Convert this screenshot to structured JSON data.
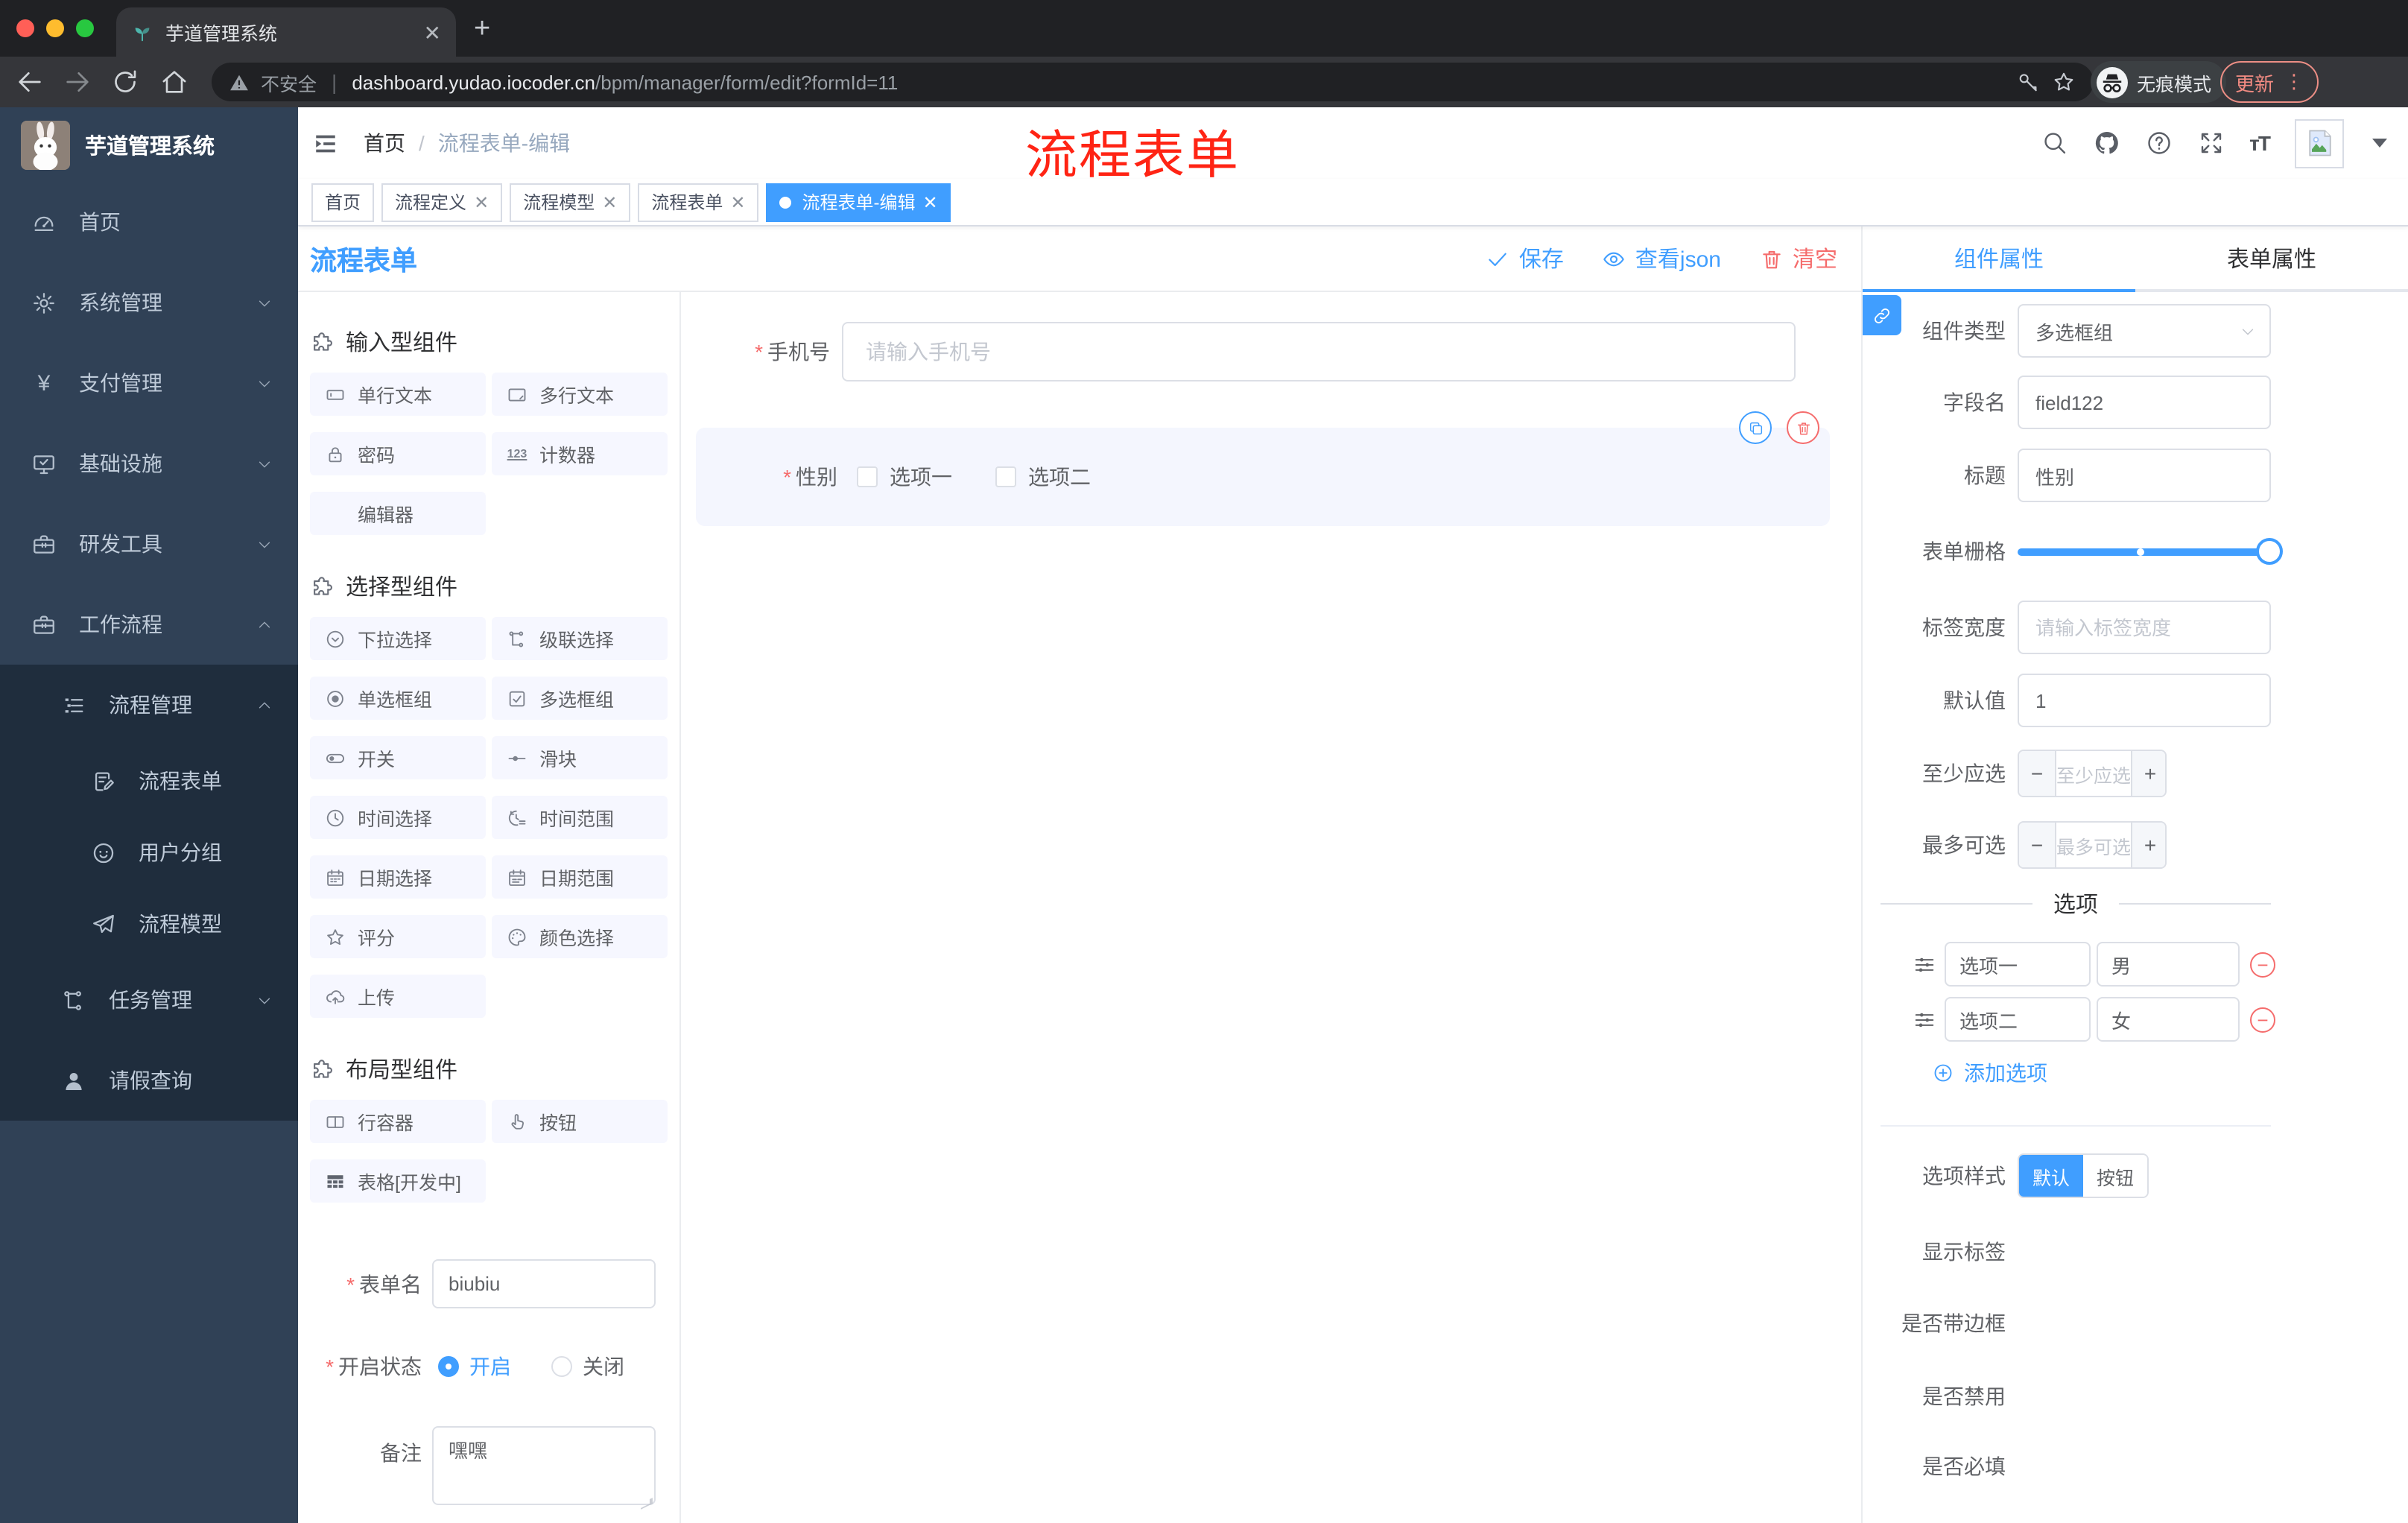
{
  "browser": {
    "tab_title": "芋道管理系统",
    "security_label": "不安全",
    "url_domain": "dashboard.yudao.iocoder.cn",
    "url_path": "/bpm/manager/form/edit?formId=11",
    "incognito_label": "无痕模式",
    "update_label": "更新"
  },
  "annotation": {
    "text": "流程表单"
  },
  "sidebar": {
    "app_title": "芋道管理系统",
    "items": [
      "首页",
      "系统管理",
      "支付管理",
      "基础设施",
      "研发工具",
      "工作流程"
    ],
    "submenu": [
      "流程管理",
      "流程表单",
      "用户分组",
      "流程模型",
      "任务管理",
      "请假查询"
    ]
  },
  "navbar": {
    "breadcrumb_home": "首页",
    "breadcrumb_sep": "/",
    "breadcrumb_current": "流程表单-编辑"
  },
  "tags_view": {
    "tabs": [
      "首页",
      "流程定义",
      "流程模型",
      "流程表单",
      "流程表单-编辑"
    ]
  },
  "designer": {
    "title": "流程表单",
    "toolbar": {
      "save": "保存",
      "view_json": "查看json",
      "clear": "清空"
    },
    "palette": {
      "groups": [
        {
          "title": "输入型组件",
          "items": [
            "单行文本",
            "多行文本",
            "密码",
            "计数器",
            "编辑器"
          ]
        },
        {
          "title": "选择型组件",
          "items": [
            "下拉选择",
            "级联选择",
            "单选框组",
            "多选框组",
            "开关",
            "滑块",
            "时间选择",
            "时间范围",
            "日期选择",
            "日期范围",
            "评分",
            "颜色选择",
            "上传"
          ]
        },
        {
          "title": "布局型组件",
          "items": [
            "行容器",
            "按钮",
            "表格[开发中]"
          ]
        }
      ]
    },
    "meta": {
      "name_label": "表单名",
      "name_value": "biubiu",
      "status_label": "开启状态",
      "status_on": "开启",
      "status_off": "关闭",
      "remark_label": "备注",
      "remark_value": "嘿嘿"
    },
    "canvas": {
      "phone_label": "手机号",
      "phone_placeholder": "请输入手机号",
      "gender_label": "性别",
      "gender_option1": "选项一",
      "gender_option2": "选项二"
    }
  },
  "props": {
    "tab_component": "组件属性",
    "tab_form": "表单属性",
    "component_type_label": "组件类型",
    "component_type_value": "多选框组",
    "field_name_label": "字段名",
    "field_name_value": "field122",
    "title_label": "标题",
    "title_value": "性别",
    "grid_label": "表单栅格",
    "label_width_label": "标签宽度",
    "label_width_placeholder": "请输入标签宽度",
    "default_label": "默认值",
    "default_value": "1",
    "min_label": "至少应选",
    "min_placeholder": "至少应选",
    "max_label": "最多可选",
    "max_placeholder": "最多可选",
    "options_title": "选项",
    "options": [
      {
        "label": "选项一",
        "value": "男"
      },
      {
        "label": "选项二",
        "value": "女"
      }
    ],
    "add_option": "添加选项",
    "style_label": "选项样式",
    "style_default": "默认",
    "style_button": "按钮",
    "switches": [
      {
        "label": "显示标签",
        "on": true
      },
      {
        "label": "是否带边框",
        "on": false
      },
      {
        "label": "是否禁用",
        "on": false
      },
      {
        "label": "是否必填",
        "on": true
      }
    ]
  }
}
